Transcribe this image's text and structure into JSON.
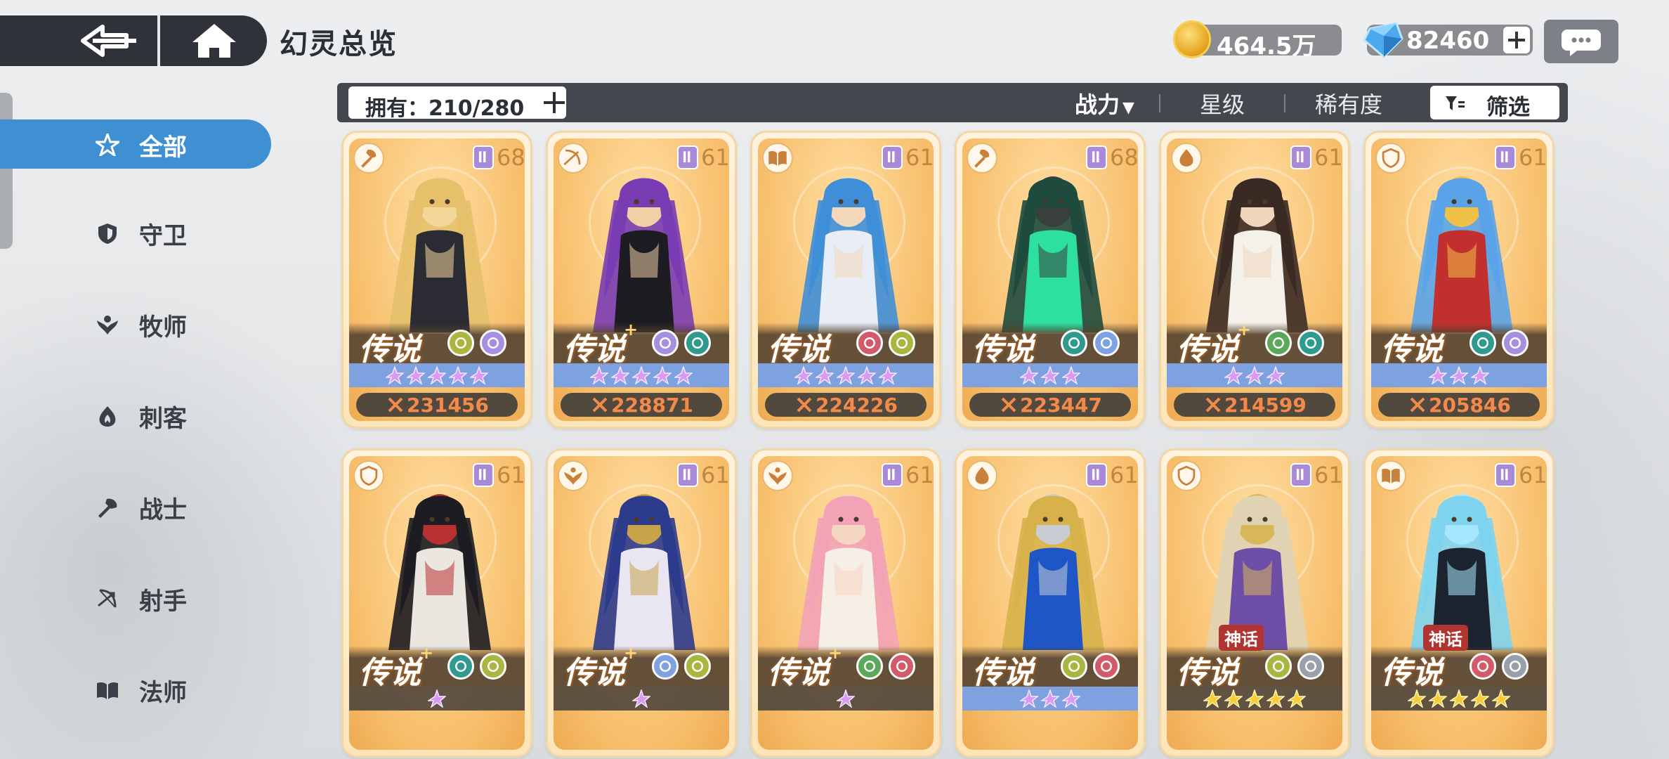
{
  "header": {
    "title": "幻灵总览",
    "back_icon": "back-arrow-icon",
    "home_icon": "home-icon"
  },
  "resources": {
    "gold": "464.5万",
    "diamonds": "82460"
  },
  "sidebar": {
    "items": [
      {
        "label": "全部",
        "icon": "all-star-icon",
        "active": true
      },
      {
        "label": "守卫",
        "icon": "shield-icon"
      },
      {
        "label": "牧师",
        "icon": "priest-wing-icon"
      },
      {
        "label": "刺客",
        "icon": "assassin-flame-icon"
      },
      {
        "label": "战士",
        "icon": "warrior-axe-icon"
      },
      {
        "label": "射手",
        "icon": "archer-bow-icon"
      },
      {
        "label": "法师",
        "icon": "mage-book-icon"
      }
    ]
  },
  "filterbar": {
    "owned": "拥有：210/280",
    "sort_power": "战力",
    "sort_star": "星级",
    "sort_rarity": "稀有度",
    "filter": "筛选"
  },
  "cards": [
    {
      "class": "warrior",
      "level": "68",
      "rarity": "传说",
      "plus": false,
      "stars": 5,
      "star_color": "purple",
      "power": "231456",
      "elements": [
        "#a9b640",
        "#a48fe0"
      ],
      "palette": [
        "#e6c06b",
        "#2a2b33",
        "#f3d79a"
      ],
      "myth": ""
    },
    {
      "class": "archer",
      "level": "61",
      "rarity": "传说",
      "plus": true,
      "stars": 5,
      "star_color": "purple",
      "power": "228871",
      "elements": [
        "#a48fe0",
        "#2f9b8e"
      ],
      "palette": [
        "#7a3cb3",
        "#1d1c22",
        "#f1d0a6"
      ],
      "myth": ""
    },
    {
      "class": "mage",
      "level": "61",
      "rarity": "传说",
      "plus": false,
      "stars": 5,
      "star_color": "purple",
      "power": "224226",
      "elements": [
        "#d35a6a",
        "#a9b640"
      ],
      "palette": [
        "#3f8fd8",
        "#e9eef6",
        "#f3d8bc"
      ],
      "myth": ""
    },
    {
      "class": "warrior",
      "level": "68",
      "rarity": "传说",
      "plus": false,
      "stars": 3,
      "star_color": "purple",
      "power": "223447",
      "elements": [
        "#2f9b8e",
        "#7fa3e2"
      ],
      "palette": [
        "#1f4a3e",
        "#2de0a0",
        "#39403c"
      ],
      "myth": ""
    },
    {
      "class": "assassin",
      "level": "61",
      "rarity": "传说",
      "plus": true,
      "stars": 3,
      "star_color": "purple",
      "power": "214599",
      "elements": [
        "#5aa85a",
        "#2f9b8e"
      ],
      "palette": [
        "#3a2a24",
        "#f4f1ea",
        "#f1d6bd"
      ],
      "myth": ""
    },
    {
      "class": "guardian",
      "level": "61",
      "rarity": "传说",
      "plus": false,
      "stars": 3,
      "star_color": "purple",
      "power": "205846",
      "elements": [
        "#2f9b8e",
        "#a48fe0"
      ],
      "palette": [
        "#5aa3e8",
        "#c22f2f",
        "#f1c046"
      ],
      "myth": ""
    },
    {
      "class": "guardian",
      "level": "61",
      "rarity": "传说",
      "plus": true,
      "stars": 1,
      "star_color": "purple",
      "power": "",
      "elements": [
        "#2f9b8e",
        "#a9b640"
      ],
      "palette": [
        "#1d1c22",
        "#eae6e0",
        "#b83030"
      ],
      "myth": ""
    },
    {
      "class": "priest",
      "level": "61",
      "rarity": "传说",
      "plus": true,
      "stars": 1,
      "star_color": "purple",
      "power": "",
      "elements": [
        "#7fa3e2",
        "#a9b640"
      ],
      "palette": [
        "#2d3b8c",
        "#e9e6f2",
        "#c9a34a"
      ],
      "myth": ""
    },
    {
      "class": "priest",
      "level": "61",
      "rarity": "传说",
      "plus": true,
      "stars": 1,
      "star_color": "purple",
      "power": "",
      "elements": [
        "#5aa85a",
        "#d35a6a"
      ],
      "palette": [
        "#f2a3b5",
        "#f6efe6",
        "#f5d6c3"
      ],
      "myth": ""
    },
    {
      "class": "assassin",
      "level": "61",
      "rarity": "传说",
      "plus": false,
      "stars": 3,
      "star_color": "purple",
      "power": "",
      "elements": [
        "#a9b640",
        "#d35a6a"
      ],
      "palette": [
        "#d7b24a",
        "#1e56c8",
        "#c9cdd3"
      ],
      "myth": ""
    },
    {
      "class": "guardian",
      "level": "61",
      "rarity": "传说",
      "plus": false,
      "stars": 5,
      "star_color": "gold",
      "power": "",
      "elements": [
        "#a9b640",
        "#9aa0aa"
      ],
      "palette": [
        "#e0d3b4",
        "#6d4fa8",
        "#d8b75a"
      ],
      "myth": "神话"
    },
    {
      "class": "mage",
      "level": "61",
      "rarity": "传说",
      "plus": false,
      "stars": 5,
      "star_color": "gold",
      "power": "",
      "elements": [
        "#d35a6a",
        "#9aa0aa"
      ],
      "palette": [
        "#7ed4ee",
        "#1c2430",
        "#a6e6ff"
      ],
      "myth": "神话"
    }
  ]
}
